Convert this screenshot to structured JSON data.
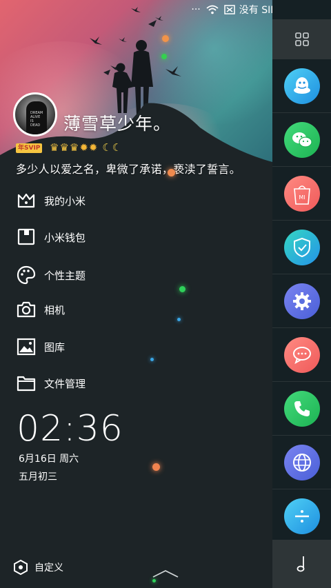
{
  "status_bar": {
    "dots": "···",
    "no_sim": "没有 SIM 卡",
    "charging": "ϟ"
  },
  "profile": {
    "username": "薄雪草少年。",
    "vip_badge": "年SVIP",
    "crowns": "♛♛♛",
    "suns": "✹✹",
    "moons": "☾☾",
    "signature": "多少人以爱之名，卑微了承诺，亵渎了誓言。"
  },
  "menu": [
    {
      "label": "我的小米",
      "icon": "mi-crown-icon"
    },
    {
      "label": "小米钱包",
      "icon": "wallet-icon"
    },
    {
      "label": "个性主题",
      "icon": "palette-icon"
    },
    {
      "label": "相机",
      "icon": "camera-icon"
    },
    {
      "label": "图库",
      "icon": "gallery-icon"
    },
    {
      "label": "文件管理",
      "icon": "folder-icon"
    }
  ],
  "clock": {
    "time": "02:36",
    "date": "6月16日 周六",
    "lunar": "五月初三"
  },
  "bottom": {
    "customize_label": "自定义"
  },
  "dock": {
    "apps": [
      {
        "name": "qq-icon",
        "color": "#2aa5e8"
      },
      {
        "name": "wechat-icon",
        "color": "#26c05d"
      },
      {
        "name": "mi-store-icon",
        "color": "#f36a66",
        "text": "MI"
      },
      {
        "name": "security-icon",
        "color": "#2fa9e0"
      },
      {
        "name": "settings-icon",
        "color": "#5a6fe0"
      },
      {
        "name": "messages-icon",
        "color": "#f46a6a"
      },
      {
        "name": "phone-icon",
        "color": "#22c06a"
      },
      {
        "name": "browser-icon",
        "color": "#5a6ae0"
      },
      {
        "name": "calculator-icon",
        "color": "#2aa8e8"
      }
    ]
  }
}
